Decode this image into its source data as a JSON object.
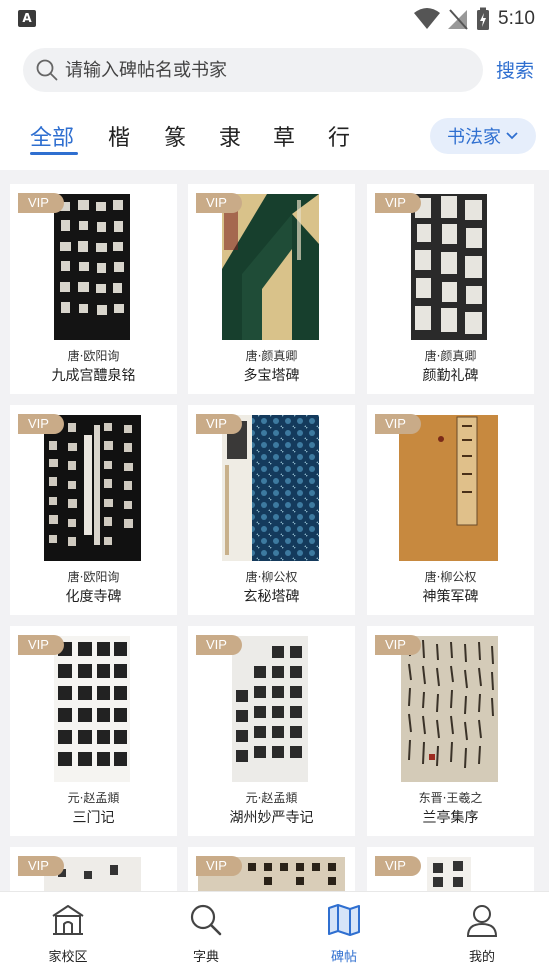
{
  "status_bar": {
    "time": "5:10"
  },
  "search": {
    "placeholder": "请输入碑帖名或书家",
    "button_label": "搜索"
  },
  "tabs": [
    {
      "label": "全部",
      "active": true
    },
    {
      "label": "楷"
    },
    {
      "label": "篆"
    },
    {
      "label": "隶"
    },
    {
      "label": "草"
    },
    {
      "label": "行"
    }
  ],
  "calligrapher_filter": {
    "label": "书法家"
  },
  "badge_label": "VIP",
  "items": [
    {
      "author": "唐·欧阳询",
      "title": "九成宫醴泉铭"
    },
    {
      "author": "唐·颜真卿",
      "title": "多宝塔碑"
    },
    {
      "author": "唐·颜真卿",
      "title": "颜勤礼碑"
    },
    {
      "author": "唐·欧阳询",
      "title": "化度寺碑"
    },
    {
      "author": "唐·柳公权",
      "title": "玄秘塔碑"
    },
    {
      "author": "唐·柳公权",
      "title": "神策军碑"
    },
    {
      "author": "元·赵孟頫",
      "title": "三门记"
    },
    {
      "author": "元·赵孟頫",
      "title": "湖州妙严寺记"
    },
    {
      "author": "东晋·王羲之",
      "title": "兰亭集序"
    }
  ],
  "bottom_nav": [
    {
      "label": "家校区"
    },
    {
      "label": "字典"
    },
    {
      "label": "碑帖",
      "active": true
    },
    {
      "label": "我的"
    }
  ],
  "colors": {
    "accent": "#2f6fd0",
    "vip": "#c9ab88"
  }
}
